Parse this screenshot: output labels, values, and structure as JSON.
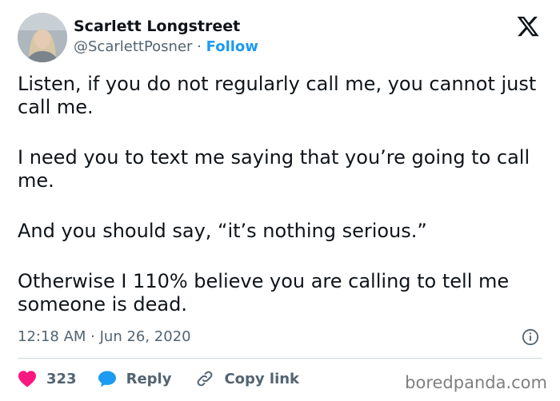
{
  "author": {
    "display_name": "Scarlett Longstreet",
    "handle": "@ScarlettPosner",
    "separator": "·",
    "follow_label": "Follow"
  },
  "brand_icon": "x-logo-icon",
  "tweet": {
    "paragraphs": [
      "Listen, if you do not regularly call me, you cannot just call me.",
      "I need you to text me saying that you’re going to call me.",
      "And you should say, “it’s nothing serious.”",
      "Otherwise I 110% believe you are calling to tell me someone is dead."
    ],
    "timestamp": "12:18 AM · Jun 26, 2020"
  },
  "actions": {
    "like_count": "323",
    "reply_label": "Reply",
    "copy_link_label": "Copy link"
  },
  "watermark": "boredpanda.com",
  "colors": {
    "accent": "#1d9bf0",
    "like": "#f91880",
    "text": "#0f1419",
    "muted": "#536471",
    "divider": "#cfd9de"
  }
}
